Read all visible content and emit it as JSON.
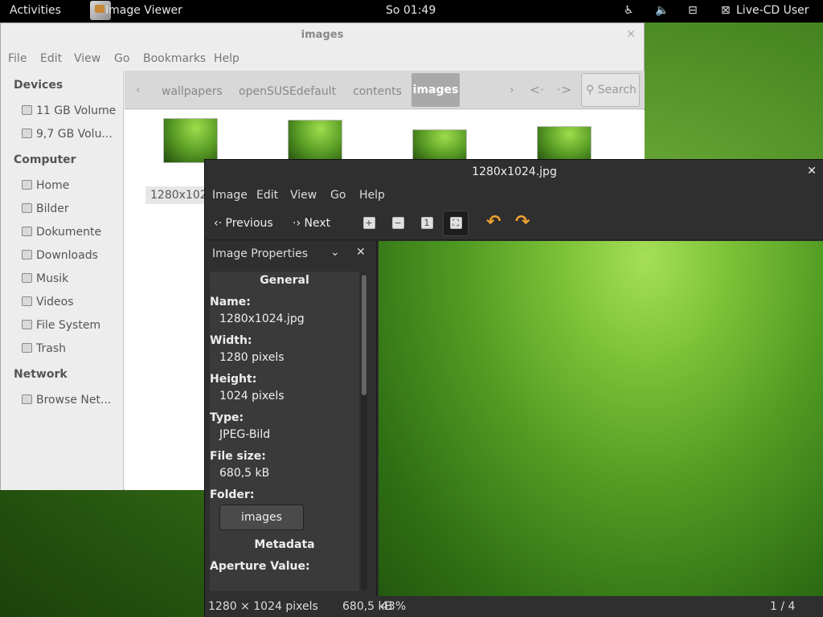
{
  "topbar": {
    "activities": "Activities",
    "app_name": "Image Viewer",
    "clock": "So 01:49",
    "user": "Live-CD User",
    "icons": [
      "accessibility-icon",
      "volume-muted-icon",
      "network-icon",
      "user-icon"
    ]
  },
  "file_manager": {
    "title": "images",
    "menu": [
      "File",
      "Edit",
      "View",
      "Go",
      "Bookmarks",
      "Help"
    ],
    "sidebar": {
      "devices_heading": "Devices",
      "devices": [
        "11 GB Volume",
        "9,7 GB Volu..."
      ],
      "computer_heading": "Computer",
      "computer": [
        "Home",
        "Bilder",
        "Dokumente",
        "Downloads",
        "Musik",
        "Videos",
        "File System",
        "Trash"
      ],
      "network_heading": "Network",
      "network": [
        "Browse Net..."
      ]
    },
    "pathbar": {
      "items": [
        "wallpapers",
        "openSUSEdefault",
        "contents"
      ],
      "active": "images",
      "search_label": "Search"
    },
    "first_thumb_label": "1280x1024.jpg"
  },
  "image_viewer": {
    "title": "1280x1024.jpg",
    "menu": [
      "Image",
      "Edit",
      "View",
      "Go",
      "Help"
    ],
    "toolbar": {
      "previous": "Previous",
      "next": "Next"
    },
    "properties": {
      "header": "Image Properties",
      "general_heading": "General",
      "name_label": "Name:",
      "name_value": "1280x1024.jpg",
      "width_label": "Width:",
      "width_value": "1280 pixels",
      "height_label": "Height:",
      "height_value": "1024 pixels",
      "type_label": "Type:",
      "type_value": "JPEG-Bild",
      "filesize_label": "File size:",
      "filesize_value": "680,5 kB",
      "folder_label": "Folder:",
      "folder_button": "images",
      "metadata_heading": "Metadata",
      "aperture_label": "Aperture Value:"
    },
    "status": {
      "dimensions": "1280 × 1024 pixels",
      "size": "680,5 kB",
      "zoom": "43%",
      "position": "1 / 4"
    }
  }
}
